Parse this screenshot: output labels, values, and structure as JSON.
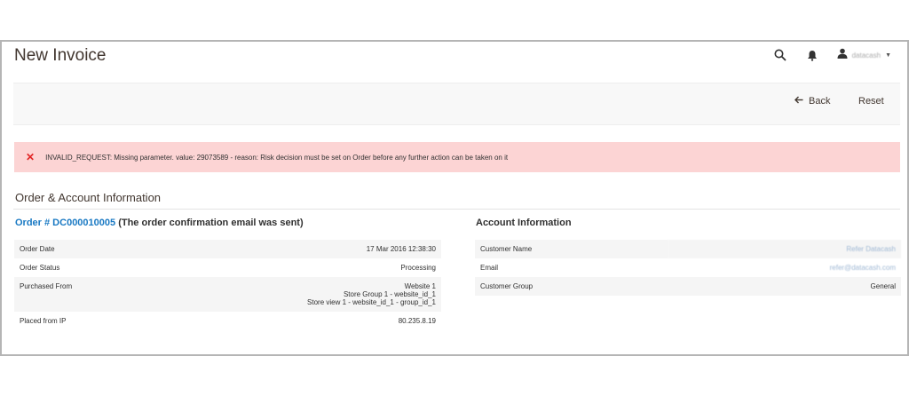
{
  "header": {
    "title": "New Invoice",
    "user_name": "datacash"
  },
  "toolbar": {
    "back_label": "Back",
    "reset_label": "Reset"
  },
  "message": {
    "text": "INVALID_REQUEST: Missing parameter. value: 29073589 - reason: Risk decision must be set on Order before any further action can be taken on it"
  },
  "section": {
    "title": "Order & Account Information"
  },
  "order": {
    "link_text": "Order # DC000010005",
    "note": "(The order confirmation email was sent)",
    "rows": [
      {
        "label": "Order Date",
        "value": "17 Mar 2016 12:38:30"
      },
      {
        "label": "Order Status",
        "value": "Processing"
      },
      {
        "label": "Purchased From",
        "value_lines": [
          "Website 1",
          "Store Group 1 - website_id_1",
          "Store view 1 - website_id_1 - group_id_1"
        ]
      },
      {
        "label": "Placed from IP",
        "value": "80.235.8.19"
      }
    ]
  },
  "account": {
    "title": "Account Information",
    "rows": [
      {
        "label": "Customer Name",
        "value": "Refer Datacash"
      },
      {
        "label": "Email",
        "value": "refer@datacash.com"
      },
      {
        "label": "Customer Group",
        "value": "General"
      }
    ]
  },
  "colors": {
    "error_bg": "#fcd4d4",
    "error_icon": "#e22626",
    "link": "#1979c3"
  }
}
